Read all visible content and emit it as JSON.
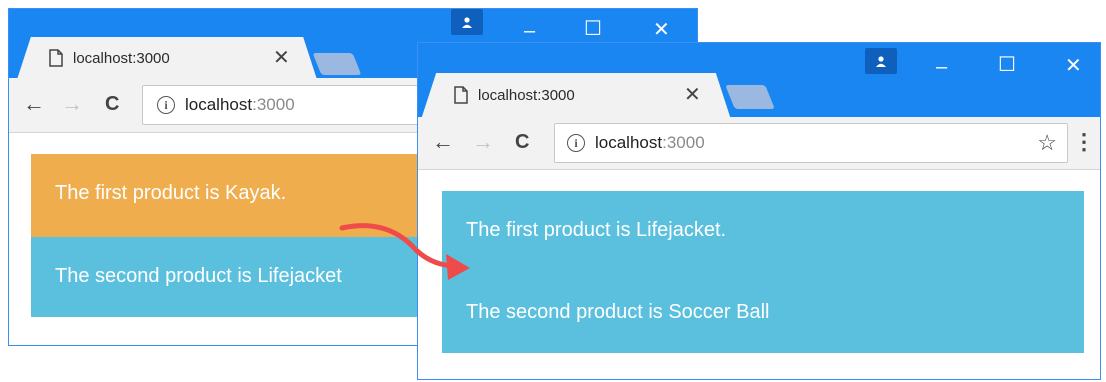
{
  "back_window": {
    "tab_title": "localhost:3000",
    "tab_close": "✕",
    "url_host": "localhost",
    "url_port": ":3000",
    "panels": {
      "first": "The first product is Kayak.",
      "second": "The second product is Lifejacket"
    }
  },
  "front_window": {
    "tab_title": "localhost:3000",
    "tab_close": "✕",
    "url_host": "localhost",
    "url_port": ":3000",
    "panels": {
      "first": "The first product is Lifejacket.",
      "second": "The second product is Soccer Ball"
    }
  },
  "window_controls": {
    "minimize": "–",
    "maximize": "☐",
    "close": "✕"
  },
  "nav": {
    "back": "←",
    "forward": "→",
    "reload": "C",
    "bookmark": "☆",
    "menu": "⋮",
    "info": "i"
  },
  "colors": {
    "titlebar": "#1a86f2",
    "panel_orange": "#efad4e",
    "panel_blue": "#5bc0de",
    "arrow": "#ef4b4b"
  }
}
